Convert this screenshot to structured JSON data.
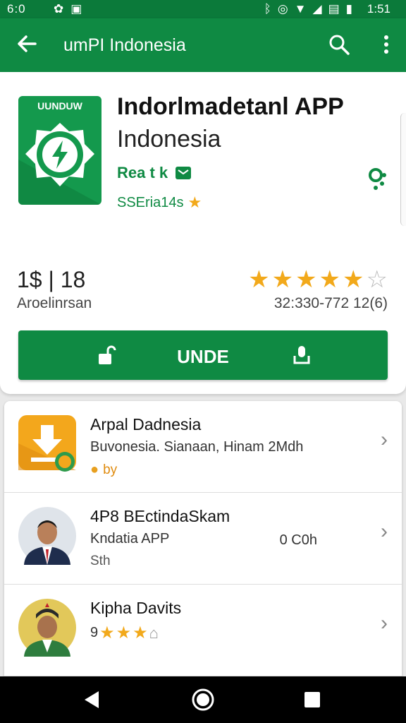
{
  "status_bar": {
    "left_time": "6:0",
    "clock": "1:51",
    "icons_left": [
      "settings-icon",
      "photo-icon"
    ],
    "icons_right": [
      "bluetooth-icon",
      "alarm-icon",
      "wifi-icon",
      "signal-icon",
      "sim-icon",
      "battery-icon"
    ]
  },
  "app_bar": {
    "title": "umPI Indonesia",
    "back_icon": "arrow-left-icon",
    "search_icon": "search-icon",
    "more_icon": "more-vert-icon"
  },
  "app": {
    "icon_label": "UUNDUW",
    "name": "Indorlmadetanl APP",
    "subtitle": "Indonesia",
    "developer": "Rea t k",
    "meta": "SSEria14s",
    "stat_value": "1$ | 18",
    "stat_label": "Aroelinrsan",
    "rating_stars": 5,
    "rating_empty": 1,
    "review_count": "32:330-772 12(6)",
    "install_label": "UNDE"
  },
  "list": [
    {
      "title": "Arpal Dadnesia",
      "subtitle": "Buvonesia. Sianaan, Hinam 2Mdh",
      "extra": "by"
    },
    {
      "title": "4P8 BEctindaSkam",
      "subtitle": "Kndatia APP",
      "aside": "0 C0h",
      "extra": "Sth"
    },
    {
      "title": "Kipha Davits",
      "extra": "9"
    }
  ],
  "colors": {
    "primary": "#0f8a43",
    "status": "#0b7a3a",
    "star": "#f2a91b"
  }
}
